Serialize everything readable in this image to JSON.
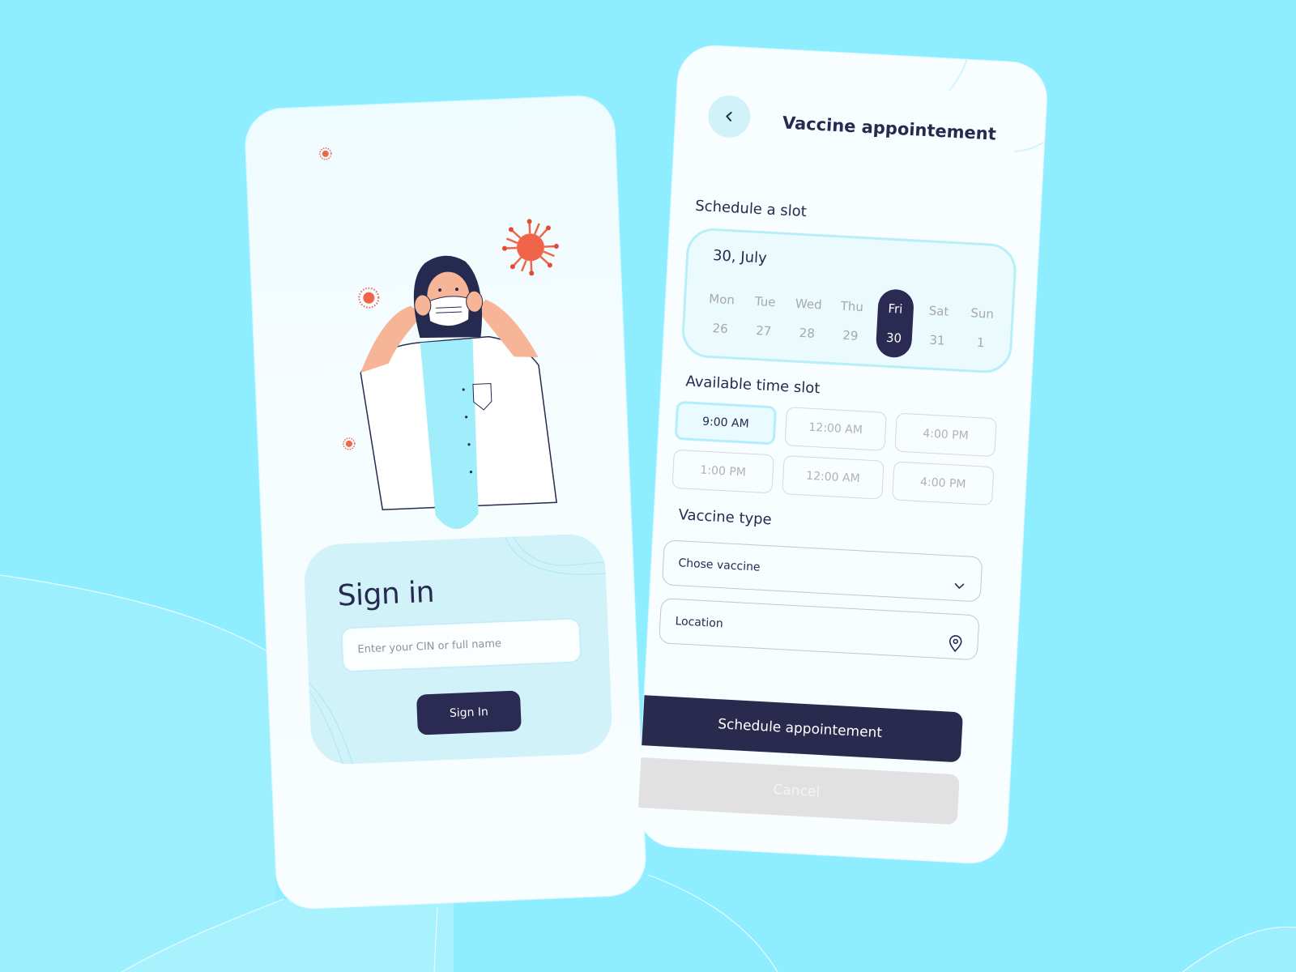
{
  "colors": {
    "background": "#8eedfe",
    "card": "#f8fdff",
    "primary": "#2a2a52",
    "accent_light": "#d2f2fa",
    "virus": "#f0654a"
  },
  "signin_screen": {
    "illustration": "doctor-wearing-mask-illustration",
    "title": "Sign in",
    "input": {
      "placeholder": "Enter your CIN or full name",
      "value": ""
    },
    "button_label": "Sign In"
  },
  "appointment_screen": {
    "back_icon": "chevron-left-icon",
    "title": "Vaccine appointement",
    "schedule_label": "Schedule a slot",
    "calendar": {
      "selected_date": "30, July",
      "days": [
        {
          "name": "Mon",
          "num": "26",
          "selected": false
        },
        {
          "name": "Tue",
          "num": "27",
          "selected": false
        },
        {
          "name": "Wed",
          "num": "28",
          "selected": false
        },
        {
          "name": "Thu",
          "num": "29",
          "selected": false
        },
        {
          "name": "Fri",
          "num": "30",
          "selected": true
        },
        {
          "name": "Sat",
          "num": "31",
          "selected": false
        },
        {
          "name": "Sun",
          "num": "1",
          "selected": false
        }
      ]
    },
    "time_slot_label": "Available time slot",
    "time_slots": [
      {
        "label": "9:00 AM",
        "selected": true
      },
      {
        "label": "12:00 AM",
        "selected": false
      },
      {
        "label": "4:00 PM",
        "selected": false
      },
      {
        "label": "1:00 PM",
        "selected": false
      },
      {
        "label": "12:00 AM",
        "selected": false
      },
      {
        "label": "4:00 PM",
        "selected": false
      }
    ],
    "vaccine_type_label": "Vaccine type",
    "vaccine_select": {
      "placeholder": "Chose vaccine",
      "icon": "chevron-down-icon"
    },
    "location_field": {
      "placeholder": "Location",
      "icon": "location-pin-icon"
    },
    "schedule_button": "Schedule appointement",
    "cancel_button": "Cancel"
  }
}
